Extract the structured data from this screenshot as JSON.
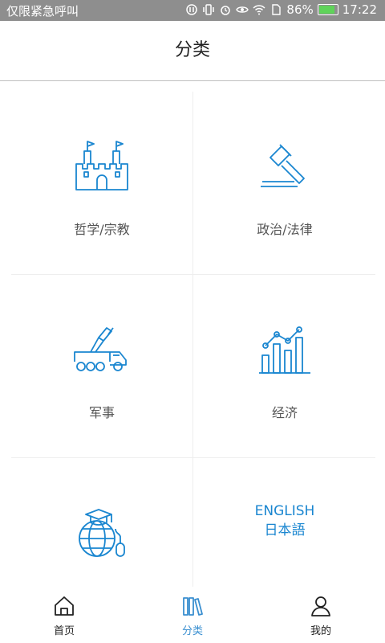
{
  "status_bar": {
    "carrier": "仅限紧急呼叫",
    "battery": "86%",
    "time": "17:22"
  },
  "header": {
    "title": "分类"
  },
  "categories": [
    {
      "label": "哲学/宗教",
      "icon": "castle-icon"
    },
    {
      "label": "政治/法律",
      "icon": "gavel-icon"
    },
    {
      "label": "军事",
      "icon": "military-truck-icon"
    },
    {
      "label": "经济",
      "icon": "bar-chart-icon"
    },
    {
      "label": "",
      "icon": "education-globe-icon"
    },
    {
      "label_en": "ENGLISH",
      "label_jp": "日本語",
      "icon": "language-text-icon"
    }
  ],
  "tabs": [
    {
      "label": "首页",
      "icon": "home-icon"
    },
    {
      "label": "分类",
      "icon": "books-icon"
    },
    {
      "label": "我的",
      "icon": "user-icon"
    }
  ],
  "colors": {
    "accent": "#1a86d0",
    "status_bar": "#8e8e8e",
    "tab_active": "#3a8fd0"
  }
}
